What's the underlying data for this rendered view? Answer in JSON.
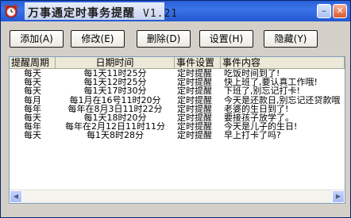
{
  "window": {
    "title": "万事通定时事务提醒",
    "version": "V1.21",
    "minimize_glyph": "–",
    "close_glyph": "✕",
    "app_icon": "alarm-clock-icon"
  },
  "toolbar": {
    "add": "添加(A)",
    "edit": "修改(E)",
    "delete": "删除(D)",
    "settings": "设置(H)",
    "hide": "隐藏(Y)"
  },
  "list": {
    "columns": [
      "提醒周期",
      "日期时间",
      "事件设置",
      "事件内容"
    ],
    "rows": [
      [
        "每天",
        "每1天11时25分",
        "定时提醒",
        "吃饭时间到了!"
      ],
      [
        "每天",
        "每1天12时25分",
        "定时提醒",
        "快上班了,要认真工作哦!"
      ],
      [
        "每天",
        "每1天17时30分",
        "定时提醒",
        "下班了,别忘记打卡!"
      ],
      [
        "每月",
        "每1月在16号11时20分",
        "定时提醒",
        "今天是还款日,别忘记还贷款哦"
      ],
      [
        "每年",
        "每年在8月3日11时22分",
        "定时提醒",
        "老婆的生日到了!"
      ],
      [
        "每天",
        "每1天18时20分",
        "定时提醒",
        "要接孩子放学了。"
      ],
      [
        "每年",
        "每年在2月12日11时11分",
        "定时提醒",
        "今天是儿子的生日!"
      ],
      [
        "每天",
        "每1天8时28分",
        "定时提醒",
        "早上打卡了吗?"
      ]
    ]
  },
  "scrollbar": {
    "left_glyph": "◀",
    "right_glyph": "▶"
  }
}
